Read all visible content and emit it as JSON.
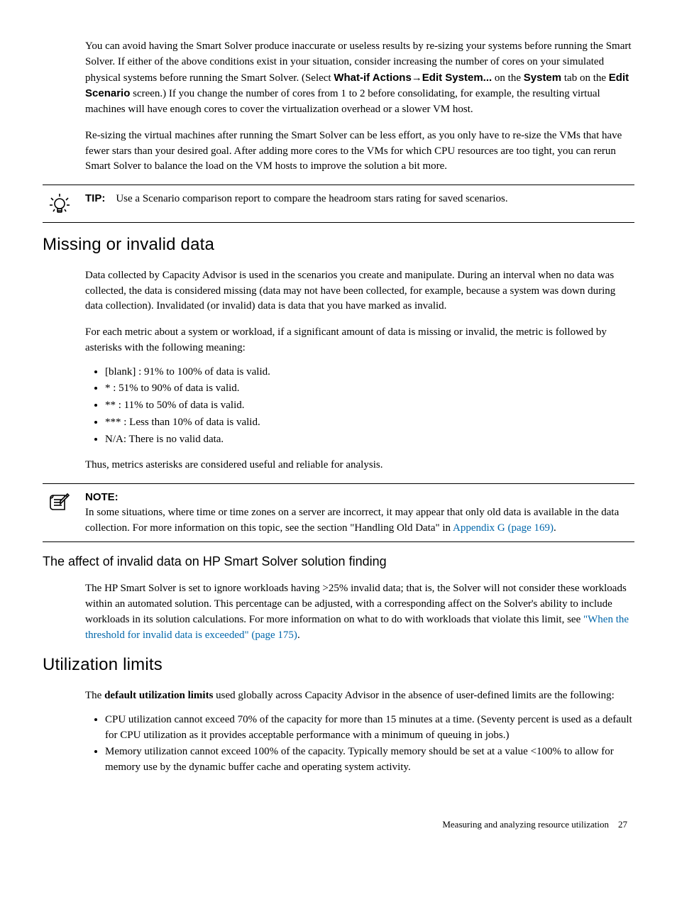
{
  "paragraphs": {
    "p1a": "You can avoid having the Smart Solver produce inaccurate or useless results by re-sizing your systems before running the Smart Solver. If either of the above conditions exist in your situation, consider increasing the number of cores on your simulated physical systems before running the Smart Solver. (Select ",
    "p1_whatif": "What-if Actions",
    "p1_arrow": "→",
    "p1_edit": "Edit System...",
    "p1b": " on the ",
    "p1_system": "System",
    "p1c": " tab on the ",
    "p1_editscen": "Edit Scenario",
    "p1d": " screen.) If you change the number of cores from 1 to 2 before consolidating, for example, the resulting virtual machines will have enough cores to cover the virtualization overhead or a slower VM host.",
    "p2": "Re-sizing the virtual machines after running the Smart Solver can be less effort, as you only have to re-size the VMs that have fewer stars than your desired goal. After adding more cores to the VMs for which CPU resources are too tight, you can rerun Smart Solver to balance the load on the VM hosts to improve the solution a bit more.",
    "tip_label": "TIP:",
    "tip_text": "Use a Scenario comparison report to compare the headroom stars rating for saved scenarios.",
    "h2_missing": "Missing or invalid data",
    "p3": "Data collected by Capacity Advisor is used in the scenarios you create and manipulate. During an interval when no data was collected, the data is considered missing (data may not have been collected, for example, because a system was down during data collection). Invalidated (or invalid) data is data that you have marked as invalid.",
    "p4": "For each metric about a system or workload, if a significant amount of data is missing or invalid, the metric is followed by asterisks with the following meaning:",
    "b1": "[blank] : 91% to 100% of data is valid.",
    "b2": "* : 51% to 90% of data is valid.",
    "b3": "** : 11% to 50% of data is valid.",
    "b4": "*** : Less than 10% of data is valid.",
    "b5": "N/A: There is no valid data.",
    "p5": "Thus, metrics asterisks are considered useful and reliable for analysis.",
    "note_label": "NOTE:",
    "note_text_a": "In some situations, where time or time zones on a server are incorrect, it may appear that only old data is available in the data collection. For more information on this topic, see the section \"Handling Old Data\" in ",
    "note_link": "Appendix G (page 169)",
    "note_text_b": ".",
    "h3_affect": "The affect of invalid data on HP Smart Solver solution finding",
    "p6a": "The HP Smart Solver is set to ignore workloads having >25% invalid data; that is, the Solver will not consider these workloads within an automated solution. This percentage can be adjusted, with a corresponding affect on the Solver's ability to include workloads in its solution calculations. For more information on what to do with workloads that violate this limit, see ",
    "p6_link": "\"When the threshold for invalid data is exceeded\" (page 175)",
    "p6b": ".",
    "h2_util": "Utilization limits",
    "p7a": "The ",
    "p7_bold": "default utilization limits",
    "p7b": " used globally across Capacity Advisor in the absence of user-defined limits are the following:",
    "ub1": "CPU utilization cannot exceed 70% of the capacity for more than 15 minutes at a time. (Seventy percent is used as a default for CPU utilization as it provides acceptable performance with a minimum of queuing in jobs.)",
    "ub2": "Memory utilization cannot exceed 100% of the capacity. Typically memory should be set at a value <100% to allow for memory use by the dynamic buffer cache and operating system activity."
  },
  "footer": {
    "section": "Measuring and analyzing resource utilization",
    "page": "27"
  }
}
